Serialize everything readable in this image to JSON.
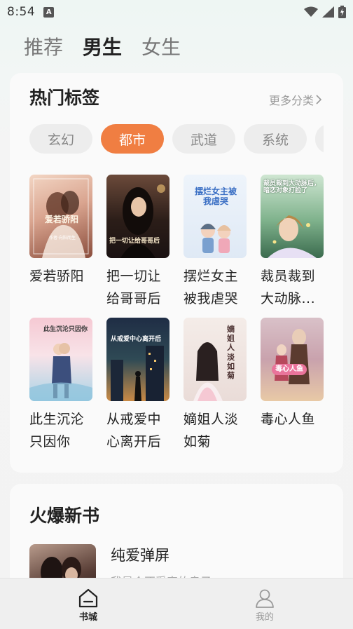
{
  "status": {
    "time": "8:54",
    "notify_badge": "A"
  },
  "top_tabs": [
    {
      "label": "推荐",
      "active": false
    },
    {
      "label": "男生",
      "active": true
    },
    {
      "label": "女生",
      "active": false
    }
  ],
  "hot_tags": {
    "title": "热门标签",
    "more_label": "更多分类",
    "categories": [
      "玄幻",
      "都市",
      "武道",
      "系统"
    ],
    "selected_category": "都市",
    "books": [
      {
        "title_line1": "爱若骄阳",
        "title_line2": "",
        "cover_text": "爱若骄阳",
        "cover_small": "作者·向阳而生"
      },
      {
        "title_line1": "把一切让",
        "title_line2": "给哥哥后",
        "cover_text": "把一切让给哥哥后"
      },
      {
        "title_line1": "摆烂女主",
        "title_line2": "被我虐哭",
        "cover_text": "摆烂女主被我虐哭"
      },
      {
        "title_line1": "裁员裁到",
        "title_line2": "大动脉...",
        "cover_text": "裁员裁到大动脉后，暗恋对象打脸了"
      },
      {
        "title_line1": "此生沉沦",
        "title_line2": "只因你",
        "cover_text": "此生沉沦只因你"
      },
      {
        "title_line1": "从戒爱中",
        "title_line2": "心离开后",
        "cover_text": "从戒爱中心离开后"
      },
      {
        "title_line1": "嫡姐人淡",
        "title_line2": "如菊",
        "cover_text": "嫡姐人淡如菊"
      },
      {
        "title_line1": "毒心人鱼",
        "title_line2": "",
        "cover_text": "毒心人鱼"
      }
    ]
  },
  "new_books": {
    "title": "火爆新书",
    "items": [
      {
        "title": "纯爱弹屏",
        "desc": "我是个不受宠的皇子"
      }
    ]
  },
  "bottom_nav": [
    {
      "label": "书城",
      "icon": "home-icon",
      "active": true
    },
    {
      "label": "我的",
      "icon": "user-icon",
      "active": false
    }
  ],
  "colors": {
    "accent": "#f07e42"
  }
}
